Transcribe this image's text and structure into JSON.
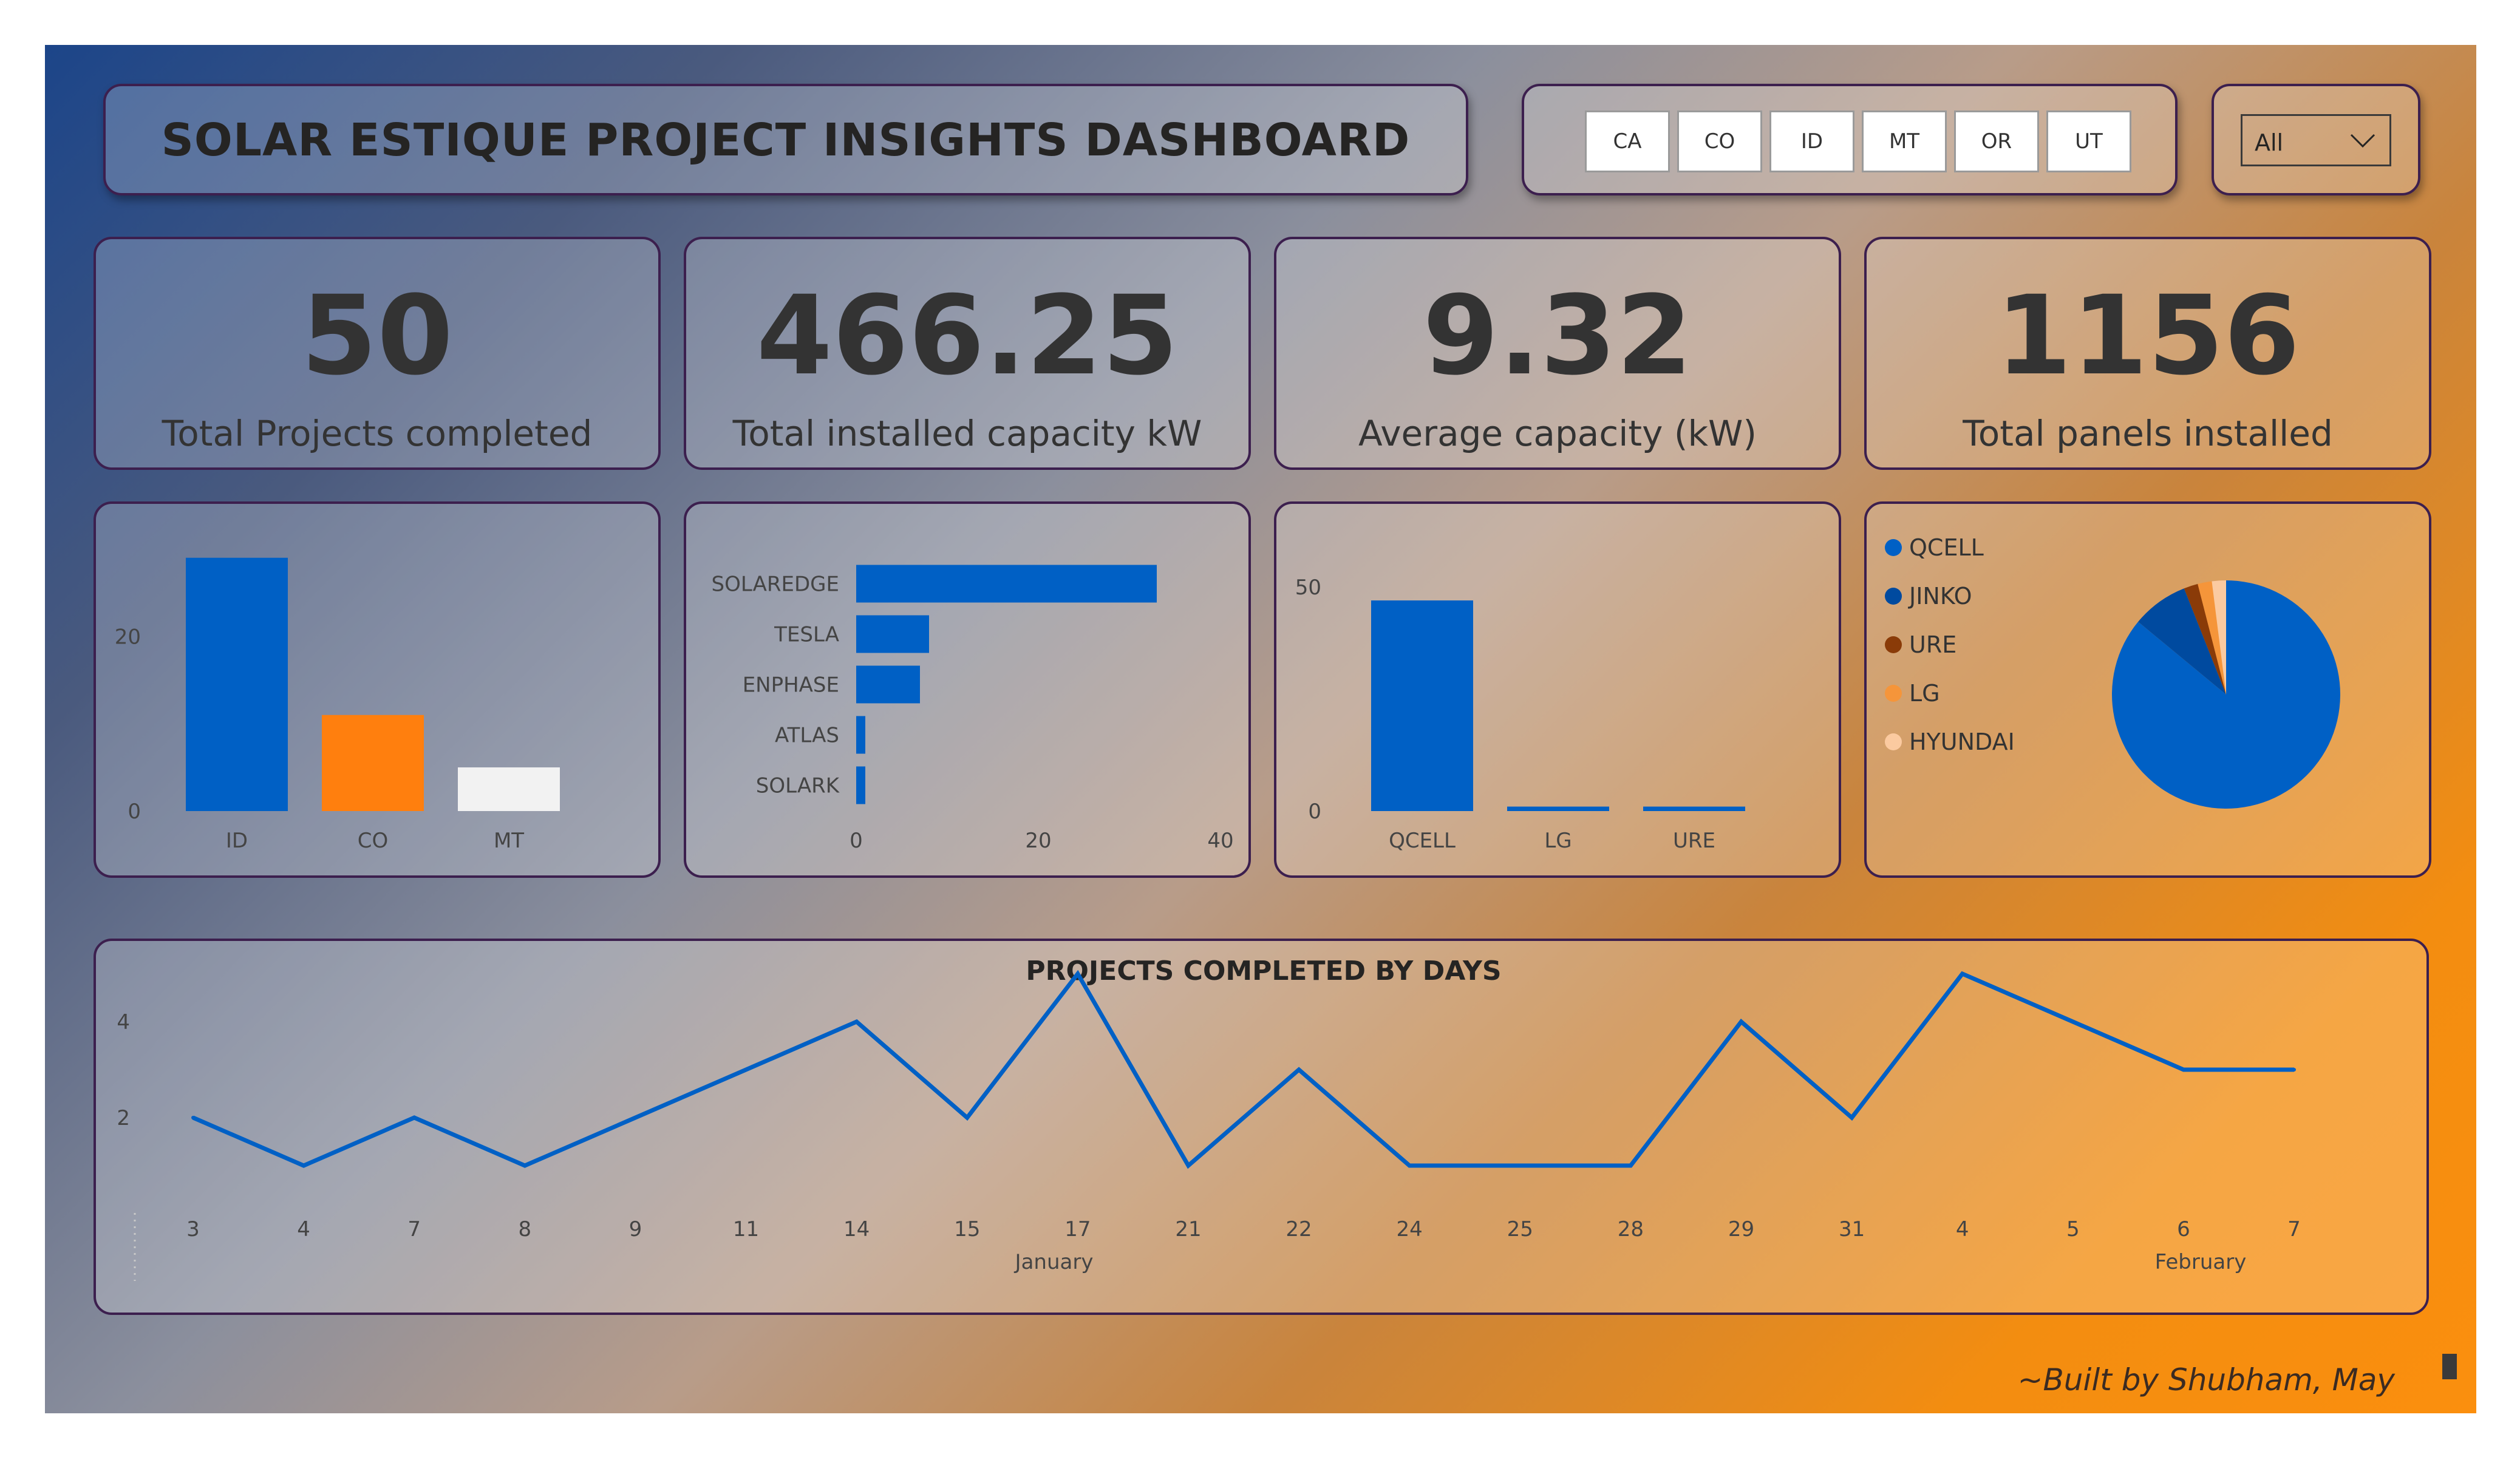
{
  "title": "SOLAR ESTIQUE PROJECT INSIGHTS DASHBOARD",
  "state_slicer": [
    "CA",
    "CO",
    "ID",
    "MT",
    "OR",
    "UT"
  ],
  "dropdown": {
    "value": "All"
  },
  "kpis": [
    {
      "value": "50",
      "label": "Total Projects completed"
    },
    {
      "value": "466.25",
      "label": "Total installed capacity kW"
    },
    {
      "value": "9.32",
      "label": "Average capacity (kW)"
    },
    {
      "value": "1156",
      "label": "Total panels installed"
    }
  ],
  "footer": "~Built by Shubham, May",
  "colors": {
    "blue": "#0060c5",
    "orange": "#ff7f0e",
    "white": "#f2f2f2",
    "navy": "#004a9f",
    "brown": "#8a3b08",
    "lightorange": "#f5953a",
    "peach": "#fbcaa0"
  },
  "chart_data": [
    {
      "type": "bar",
      "orientation": "vertical",
      "categories": [
        "ID",
        "CO",
        "MT"
      ],
      "values": [
        29,
        11,
        5
      ],
      "colors": [
        "#0060c5",
        "#ff7f0e",
        "#f2f2f2"
      ],
      "ylim": [
        0,
        31
      ],
      "yticks": [
        "0",
        "20"
      ],
      "ytick_values": [
        0,
        20
      ],
      "grid": false
    },
    {
      "type": "bar",
      "orientation": "horizontal",
      "categories": [
        "SOLAREDGE",
        "TESLA",
        "ENPHASE",
        "ATLAS",
        "SOLARK"
      ],
      "values": [
        33,
        8,
        7,
        1,
        1
      ],
      "xlim": [
        0,
        40
      ],
      "xticks": [
        "0",
        "20",
        "40"
      ],
      "xtick_values": [
        0,
        20,
        40
      ],
      "color": "#0060c5"
    },
    {
      "type": "bar",
      "orientation": "vertical",
      "categories": [
        "QCELL",
        "LG",
        "URE"
      ],
      "values": [
        47,
        1,
        1
      ],
      "ylim": [
        0,
        55
      ],
      "yticks": [
        "0",
        "50"
      ],
      "ytick_values": [
        0,
        50
      ],
      "color": "#0060c5"
    },
    {
      "type": "pie",
      "labels": [
        "QCELL",
        "JINKO",
        "URE",
        "LG",
        "HYUNDAI"
      ],
      "values": [
        43,
        4,
        1,
        1,
        1
      ],
      "colors": [
        "#0060c5",
        "#004a9f",
        "#8a3b08",
        "#f5953a",
        "#fbcaa0"
      ],
      "legend": "left"
    },
    {
      "type": "line",
      "title": "PROJECTS COMPLETED BY DAYS",
      "x": [
        "3",
        "4",
        "7",
        "8",
        "9",
        "11",
        "14",
        "15",
        "17",
        "21",
        "22",
        "24",
        "25",
        "28",
        "29",
        "31",
        "4",
        "5",
        "6",
        "7"
      ],
      "values": [
        2,
        1,
        2,
        1,
        2,
        3,
        4,
        2,
        5,
        1,
        3,
        1,
        1,
        1,
        4,
        2,
        5,
        4,
        3,
        3
      ],
      "month_labels": [
        "January",
        "February"
      ],
      "yticks": [
        "2",
        "4"
      ],
      "ytick_values": [
        2,
        4
      ],
      "ylim": [
        0.5,
        5
      ],
      "color": "#0060c5"
    }
  ]
}
